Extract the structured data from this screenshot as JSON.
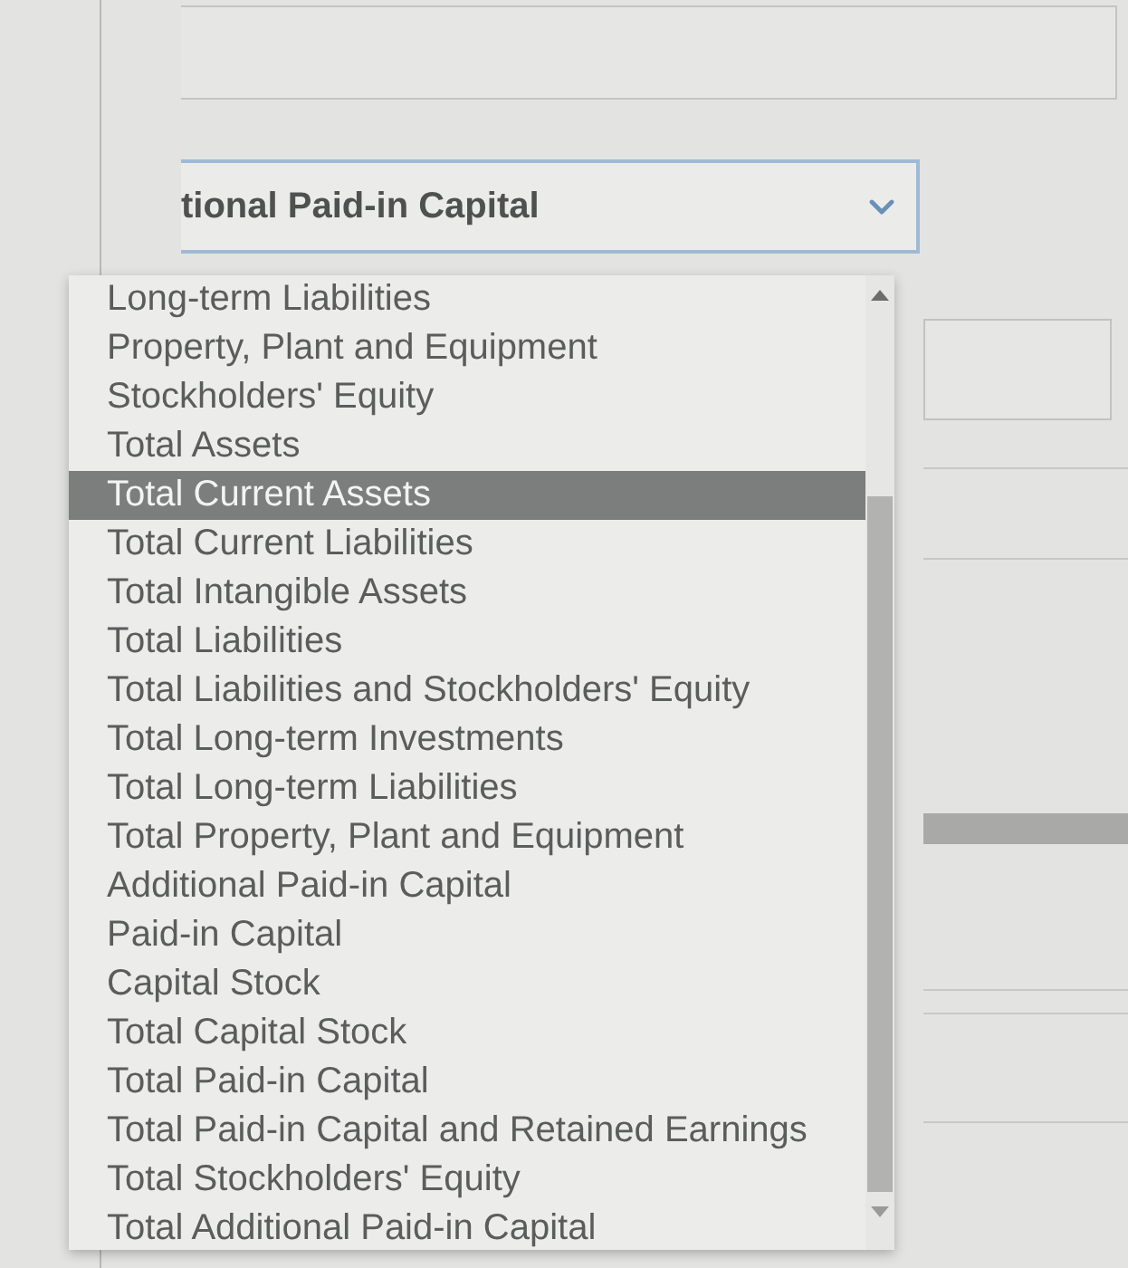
{
  "select": {
    "value": "tional Paid-in Capital",
    "expanded": true
  },
  "options": [
    {
      "label": "Long-term Liabilities",
      "selected": false
    },
    {
      "label": "Property, Plant and Equipment",
      "selected": false
    },
    {
      "label": "Stockholders' Equity",
      "selected": false
    },
    {
      "label": "Total Assets",
      "selected": false
    },
    {
      "label": "Total Current Assets",
      "selected": true
    },
    {
      "label": "Total Current Liabilities",
      "selected": false
    },
    {
      "label": "Total Intangible Assets",
      "selected": false
    },
    {
      "label": "Total Liabilities",
      "selected": false
    },
    {
      "label": "Total Liabilities and Stockholders' Equity",
      "selected": false
    },
    {
      "label": "Total Long-term Investments",
      "selected": false
    },
    {
      "label": "Total Long-term Liabilities",
      "selected": false
    },
    {
      "label": "Total Property, Plant and Equipment",
      "selected": false
    },
    {
      "label": "Additional Paid-in Capital",
      "selected": false
    },
    {
      "label": "Paid-in Capital",
      "selected": false
    },
    {
      "label": "Capital Stock",
      "selected": false
    },
    {
      "label": "Total Capital Stock",
      "selected": false
    },
    {
      "label": "Total Paid-in Capital",
      "selected": false
    },
    {
      "label": "Total Paid-in Capital and Retained Earnings",
      "selected": false
    },
    {
      "label": "Total Stockholders' Equity",
      "selected": false
    },
    {
      "label": "Total Additional Paid-in Capital",
      "selected": false
    }
  ]
}
